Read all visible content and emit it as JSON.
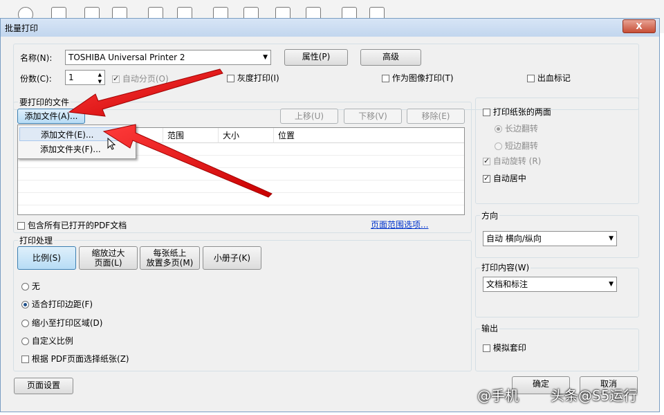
{
  "dialog_title": "批量打印",
  "close_label": "X",
  "printer": {
    "name_label": "名称(N):",
    "name_value": "TOSHIBA Universal Printer 2",
    "properties_button": "属性(P)",
    "advanced_button": "高级",
    "copies_label": "份数(C):",
    "copies_value": "1",
    "collate_label": "自动分页(O)",
    "grayscale_label": "灰度打印(I)",
    "print_as_image_label": "作为图像打印(T)",
    "bleed_marks_label": "出血标记"
  },
  "files": {
    "group_label": "要打印的文件",
    "add_files_button": "添加文件(A)...",
    "move_up_button": "上移(U)",
    "move_down_button": "下移(V)",
    "remove_button": "移除(E)",
    "columns": [
      "",
      "间",
      "范围",
      "大小",
      "位置"
    ],
    "include_open_label": "包含所有已打开的PDF文档",
    "page_range_link": "页面范围选项..."
  },
  "add_menu": {
    "items": [
      "添加文件(E)...",
      "添加文件夹(F)..."
    ]
  },
  "handling": {
    "group_label": "打印处理",
    "buttons": [
      "比例(S)",
      "缩放过大\n页面(L)",
      "每张纸上\n放置多页(M)",
      "小册子(K)"
    ],
    "options": [
      "无",
      "适合打印边距(F)",
      "缩小至打印区域(D)",
      "自定义比例"
    ],
    "selected_option": "适合打印边距(F)",
    "choose_paper_label": "根据 PDF页面选择纸张(Z)"
  },
  "duplex": {
    "both_sides_label": "打印纸张的两面",
    "long_edge_label": "长边翻转",
    "short_edge_label": "短边翻转",
    "auto_rotate_label": "自动旋转 (R)",
    "auto_center_label": "自动居中"
  },
  "orientation": {
    "group_label": "方向",
    "value": "自动 横向/纵向"
  },
  "content": {
    "group_label": "打印内容(W)",
    "value": "文档和标注"
  },
  "output": {
    "group_label": "输出",
    "simulate_overprint_label": "模拟套印"
  },
  "footer": {
    "page_setup_button": "页面设置",
    "ok_button": "确定",
    "cancel_button": "取消"
  },
  "watermark_text": "头条@S5运行",
  "watermark_text2": "@手机"
}
